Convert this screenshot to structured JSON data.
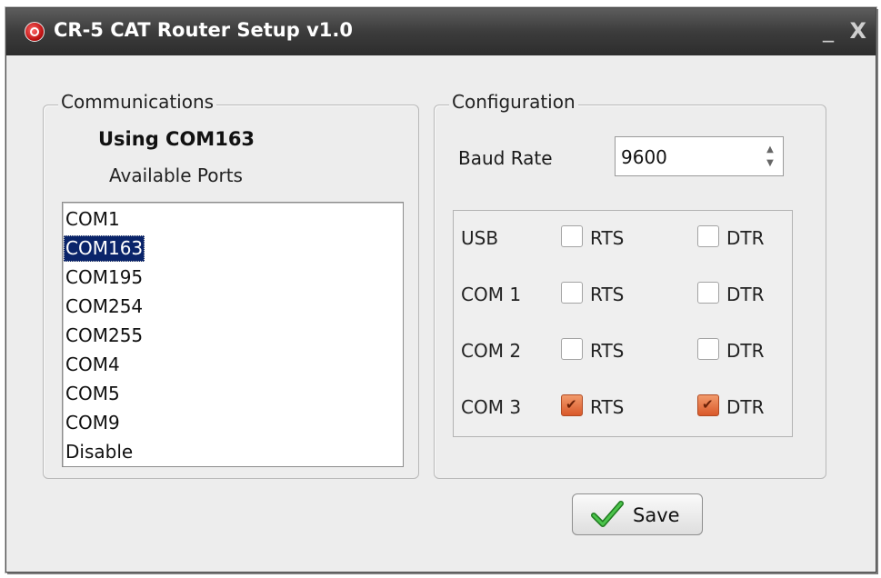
{
  "window": {
    "title": "CR-5 CAT Router Setup v1.0",
    "minimize_glyph": "_",
    "close_glyph": "X"
  },
  "communications": {
    "legend": "Communications",
    "using_label": "Using COM163",
    "available_label": "Available Ports",
    "ports": [
      "COM1",
      "COM163",
      "COM195",
      "COM254",
      "COM255",
      "COM4",
      "COM5",
      "COM9",
      "Disable"
    ],
    "selected_port": "COM163"
  },
  "configuration": {
    "legend": "Configuration",
    "baud_label": "Baud Rate",
    "baud_value": "9600",
    "rows": [
      {
        "label": "USB",
        "rts_label": "RTS",
        "dtr_label": "DTR",
        "rts": false,
        "dtr": false
      },
      {
        "label": "COM 1",
        "rts_label": "RTS",
        "dtr_label": "DTR",
        "rts": false,
        "dtr": false
      },
      {
        "label": "COM 2",
        "rts_label": "RTS",
        "dtr_label": "DTR",
        "rts": false,
        "dtr": false
      },
      {
        "label": "COM 3",
        "rts_label": "RTS",
        "dtr_label": "DTR",
        "rts": true,
        "dtr": true
      }
    ]
  },
  "actions": {
    "save_label": "Save",
    "save_icon": "check-icon"
  },
  "colors": {
    "selection_bg": "#0a246a",
    "checkbox_checked": "#e0693a",
    "title_bar": "#3c3c3c",
    "save_check": "#2e9a2e"
  }
}
